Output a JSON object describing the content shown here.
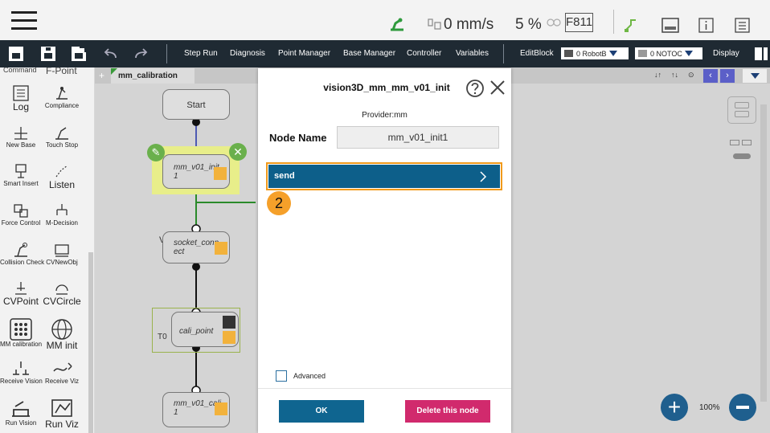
{
  "status": {
    "speed": "0 mm/s",
    "percent": "5 %",
    "code": "F811"
  },
  "toolbar": {
    "items": [
      "Step Run",
      "Diagnosis",
      "Point Manager",
      "Base Manager",
      "Controller",
      "Variables"
    ],
    "edit_block": "EditBlock",
    "robot_dd": "0 RobotB",
    "tool_dd": "0 NOTOC",
    "display": "Display"
  },
  "palette": {
    "top_labels": [
      "Command",
      "F-Point"
    ],
    "items": [
      {
        "label": "Log",
        "big": true
      },
      {
        "label": "Compliance",
        "big": false
      },
      {
        "label": "New Base",
        "big": false
      },
      {
        "label": "Touch Stop",
        "big": false
      },
      {
        "label": "Smart Insert",
        "big": false
      },
      {
        "label": "Listen",
        "big": true
      },
      {
        "label": "Force Control",
        "big": false
      },
      {
        "label": "M-Decision",
        "big": false
      },
      {
        "label": "Collision Check",
        "big": false
      },
      {
        "label": "CVNewObj",
        "big": false
      },
      {
        "label": "CVPoint",
        "big": true
      },
      {
        "label": "CVCircle",
        "big": true
      },
      {
        "label": "MM calibration",
        "big": false
      },
      {
        "label": "MM init",
        "big": true
      },
      {
        "label": "Receive Vision",
        "big": false
      },
      {
        "label": "Receive Viz",
        "big": false
      },
      {
        "label": "Run Vision",
        "big": false
      },
      {
        "label": "Run Viz",
        "big": true
      }
    ]
  },
  "canvas": {
    "tab": "mm_calibration",
    "nodes": {
      "start": "Start",
      "init": "mm_v01_init\n1",
      "socket_prefix": "V",
      "socket": "socket_conn\nect",
      "cali_prefix": "T0",
      "cali": "cali_point",
      "cali2": "mm_v01_cali\n1"
    },
    "zoom": "100%"
  },
  "dialog": {
    "title": "vision3D_mm_mm_v01_init",
    "provider": "Provider:mm",
    "node_name_label": "Node Name",
    "node_name_value": "mm_v01_init1",
    "send_label": "send",
    "step_badge": "2",
    "advanced_label": "Advanced",
    "advanced_checked": false,
    "ok_label": "OK",
    "delete_label": "Delete this node"
  },
  "colors": {
    "toolbar_bg": "#1f2a33",
    "send_bg": "#0d5f8a",
    "highlight": "#f19a1b",
    "delete_bg": "#d12a6d",
    "ok_bg": "#0f6590"
  }
}
